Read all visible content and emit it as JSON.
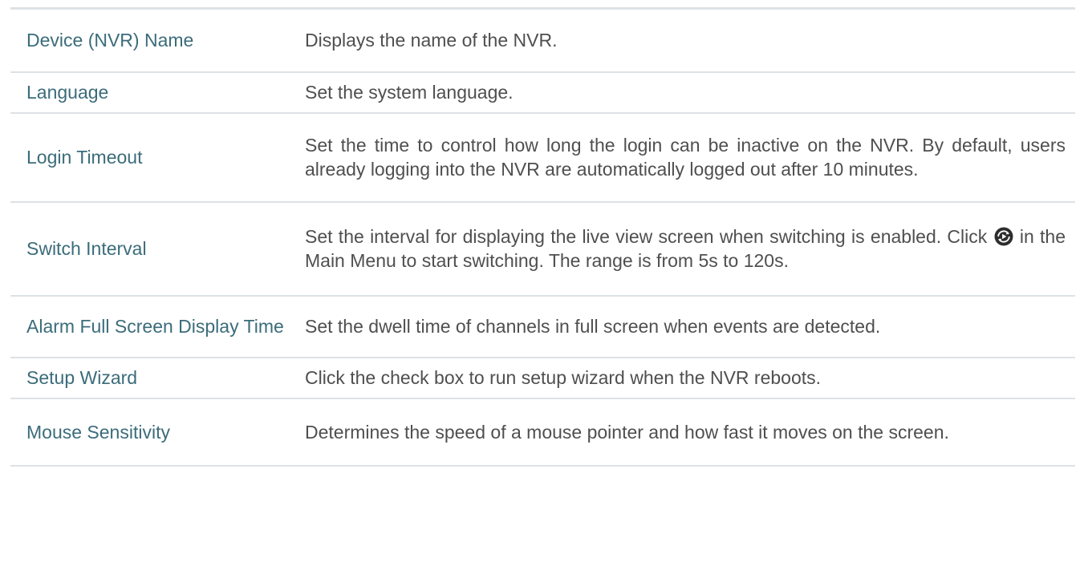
{
  "rows": [
    {
      "name": "Device (NVR) Name",
      "description": "Displays the name of the NVR."
    },
    {
      "name": "Language",
      "description": "Set the system language."
    },
    {
      "name": "Login Timeout",
      "description": "Set the time to control how long the login can be inactive on the NVR. By default, users already logging into the NVR are automatically logged out after 10 minutes."
    },
    {
      "name": "Switch Interval",
      "description_before_icon": "Set the interval for displaying the live view screen when switching is enabled. Click",
      "icon": "switching-icon",
      "description_after_icon": "in the Main Menu to start switching. The range is from 5s to 120s."
    },
    {
      "name": "Alarm Full Screen Display Time",
      "description": "Set the dwell time of channels in full screen when events are detected."
    },
    {
      "name": "Setup Wizard",
      "description": "Click the check box to run setup wizard when the NVR reboots."
    },
    {
      "name": "Mouse Sensitivity",
      "description": "Determines the speed of a mouse pointer and how fast it moves on the screen."
    }
  ],
  "colors": {
    "name_text": "#3b6c7a",
    "description_text": "#4f4f4f",
    "divider": "#dde2e6",
    "icon_background": "#2d2d2d"
  }
}
